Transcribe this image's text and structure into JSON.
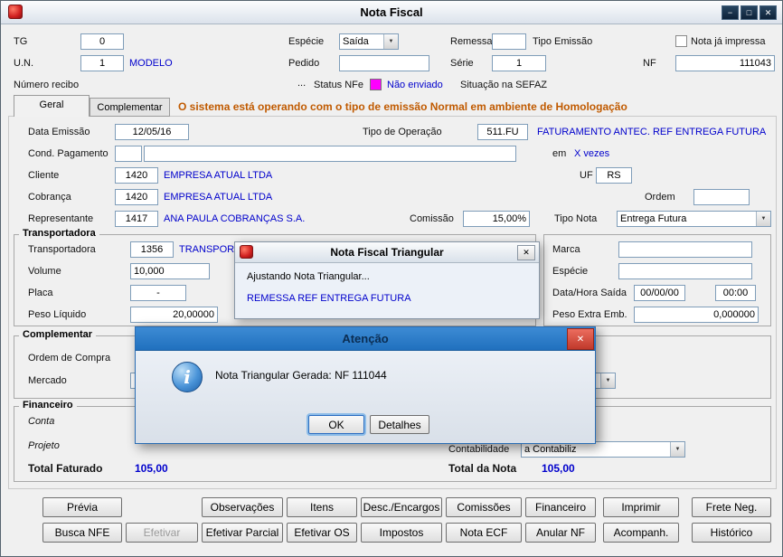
{
  "icons": {
    "chevron_down": "▼",
    "minimize": "−",
    "maximize": "□",
    "close": "✕",
    "browse": "...",
    "info": "i"
  },
  "colors": {
    "status_nfe_box": "#ff00ff",
    "data_blue": "#0000cc",
    "ambiente_orange": "#c05a00",
    "atencao_titlebar": "#2b7bc8",
    "close_button_red": "#c0392b"
  },
  "window": {
    "title": "Nota Fiscal"
  },
  "top": {
    "tg_label": "TG",
    "tg_value": "0",
    "especie_label": "Espécie",
    "especie_value": "Saída",
    "remessa_label": "Remessa",
    "remessa_value": "",
    "tipo_emissao_label": "Tipo Emissão",
    "nota_ja_impressa_label": "Nota já impressa",
    "un_label": "U.N.",
    "un_value": "1",
    "un_desc": "MODELO",
    "pedido_label": "Pedido",
    "pedido_value": "",
    "serie_label": "Série",
    "serie_value": "1",
    "nf_label": "NF",
    "nf_value": "111043",
    "numero_recibo_label": "Número recibo",
    "status_nfe_label": "Status NFe",
    "status_nfe_value": "Não enviado",
    "situacao_sefaz_label": "Situação na SEFAZ"
  },
  "tabs": {
    "geral": "Geral",
    "complementar": "Complementar",
    "ambiente_msg": "O sistema está operando com o tipo de emissão Normal em ambiente de Homologação"
  },
  "geral": {
    "data_emissao_label": "Data Emissão",
    "data_emissao_value": "12/05/16",
    "tipo_operacao_label": "Tipo de Operação",
    "tipo_operacao_value": "511.FU",
    "tipo_operacao_desc": "FATURAMENTO ANTEC. REF ENTREGA FUTURA",
    "cond_pagamento_label": "Cond. Pagamento",
    "cond_pagamento_value1": "",
    "cond_pagamento_value2": "",
    "em_label": "em",
    "vezes_value": "X vezes",
    "cliente_label": "Cliente",
    "cliente_value": "1420",
    "cliente_desc": "EMPRESA ATUAL LTDA",
    "uf_label": "UF",
    "uf_value": "RS",
    "cobranca_label": "Cobrança",
    "cobranca_value": "1420",
    "cobranca_desc": "EMPRESA ATUAL LTDA",
    "ordem_label": "Ordem",
    "ordem_value": "",
    "representante_label": "Representante",
    "representante_value": "1417",
    "representante_desc": "ANA PAULA COBRANÇAS S.A.",
    "comissao_label": "Comissão",
    "comissao_value": "15,00%",
    "tipo_nota_label": "Tipo Nota",
    "tipo_nota_value": "Entrega Futura"
  },
  "transportadora": {
    "caption": "Transportadora",
    "transportadora_label": "Transportadora",
    "transportadora_value": "1356",
    "transportadora_desc": "TRANSPORTA",
    "volume_label": "Volume",
    "volume_value": "10,000",
    "placa_label": "Placa",
    "placa_value": "-",
    "peso_liquido_label": "Peso Líquido",
    "peso_liquido_value": "20,00000",
    "marca_label": "Marca",
    "marca_value": "",
    "especie_label": "Espécie",
    "especie_value": "",
    "data_hora_saida_label": "Data/Hora Saída",
    "data_saida_value": "00/00/00",
    "hora_saida_value": "00:00",
    "peso_extra_label": "Peso Extra Emb.",
    "peso_extra_value": "0,000000"
  },
  "complementar": {
    "caption": "Complementar",
    "ordem_compra_label": "Ordem de Compra",
    "mercado_label": "Mercado"
  },
  "financeiro": {
    "caption": "Financeiro",
    "conta_label": "Conta",
    "projeto_label": "Projeto",
    "contabilidade_label": "Contabilidade",
    "contabilidade_value": "a Contabiliz",
    "total_faturado_label": "Total Faturado",
    "total_faturado_value": "105,00",
    "total_nota_label": "Total da Nota",
    "total_nota_value": "105,00"
  },
  "footer": {
    "row1": [
      "Prévia",
      "Observações",
      "Itens",
      "Desc./Encargos",
      "Comissões",
      "Financeiro",
      "Imprimir",
      "Frete Neg."
    ],
    "row2": [
      "Busca NFE",
      "Efetivar",
      "Efetivar Parcial",
      "Efetivar OS",
      "Impostos",
      "Nota ECF",
      "Anular NF",
      "Acompanh.",
      "Histórico"
    ]
  },
  "dialog_triangular": {
    "title": "Nota Fiscal Triangular",
    "line1": "Ajustando Nota Triangular...",
    "line2": "REMESSA REF ENTREGA FUTURA"
  },
  "dialog_atencao": {
    "title": "Atenção",
    "message": "Nota Triangular Gerada: NF 111044",
    "ok_label": "OK",
    "detalhes_label": "Detalhes"
  }
}
